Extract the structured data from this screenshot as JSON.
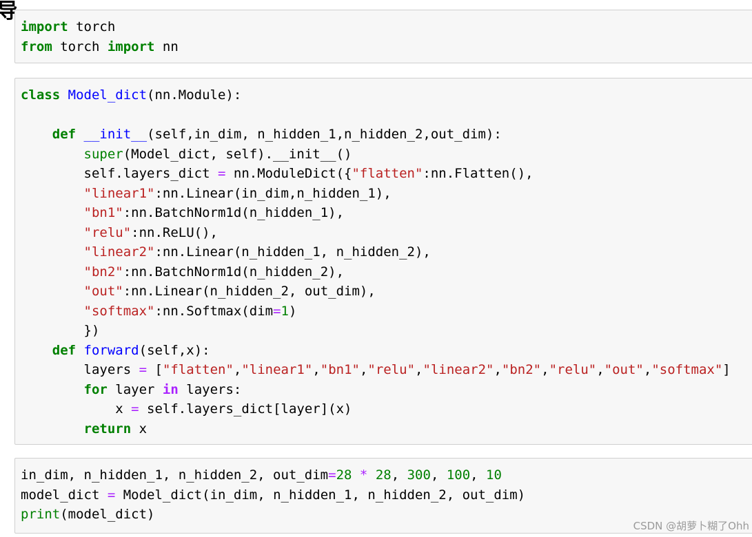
{
  "heading_fragment": "导",
  "cells": [
    {
      "lines": [
        [
          [
            "import",
            "kw"
          ],
          [
            " torch",
            ""
          ]
        ],
        [
          [
            "from",
            "kw"
          ],
          [
            " torch ",
            ""
          ],
          [
            "import",
            "kw"
          ],
          [
            " nn",
            ""
          ]
        ]
      ]
    },
    {
      "lines": [
        [
          [
            "class",
            "kw"
          ],
          [
            " ",
            ""
          ],
          [
            "Model_dict",
            "nc"
          ],
          [
            "(nn.Module):",
            ""
          ]
        ],
        [],
        [
          [
            "    ",
            ""
          ],
          [
            "def",
            "kw"
          ],
          [
            " ",
            ""
          ],
          [
            "__init__",
            "nf"
          ],
          [
            "(self,in_dim, n_hidden_1,n_hidden_2,out_dim):",
            ""
          ]
        ],
        [
          [
            "        ",
            ""
          ],
          [
            "super",
            "bi"
          ],
          [
            "(Model_dict, self).__init__()",
            ""
          ]
        ],
        [
          [
            "        self.layers_dict ",
            ""
          ],
          [
            "=",
            "o"
          ],
          [
            " nn.ModuleDict({",
            ""
          ],
          [
            "\"flatten\"",
            "s"
          ],
          [
            ":nn.Flatten(),",
            ""
          ]
        ],
        [
          [
            "        ",
            ""
          ],
          [
            "\"linear1\"",
            "s"
          ],
          [
            ":nn.Linear(in_dim,n_hidden_1),",
            ""
          ]
        ],
        [
          [
            "        ",
            ""
          ],
          [
            "\"bn1\"",
            "s"
          ],
          [
            ":nn.BatchNorm1d(n_hidden_1),",
            ""
          ]
        ],
        [
          [
            "        ",
            ""
          ],
          [
            "\"relu\"",
            "s"
          ],
          [
            ":nn.ReLU(),",
            ""
          ]
        ],
        [
          [
            "        ",
            ""
          ],
          [
            "\"linear2\"",
            "s"
          ],
          [
            ":nn.Linear(n_hidden_1, n_hidden_2),",
            ""
          ]
        ],
        [
          [
            "        ",
            ""
          ],
          [
            "\"bn2\"",
            "s"
          ],
          [
            ":nn.BatchNorm1d(n_hidden_2),",
            ""
          ]
        ],
        [
          [
            "        ",
            ""
          ],
          [
            "\"out\"",
            "s"
          ],
          [
            ":nn.Linear(n_hidden_2, out_dim),",
            ""
          ]
        ],
        [
          [
            "        ",
            ""
          ],
          [
            "\"softmax\"",
            "s"
          ],
          [
            ":nn.Softmax(dim",
            ""
          ],
          [
            "=",
            "o"
          ],
          [
            "1",
            "m"
          ],
          [
            ")",
            ""
          ]
        ],
        [
          [
            "        })",
            ""
          ]
        ],
        [
          [
            "    ",
            ""
          ],
          [
            "def",
            "kw"
          ],
          [
            " ",
            ""
          ],
          [
            "forward",
            "nf"
          ],
          [
            "(self,x):",
            ""
          ]
        ],
        [
          [
            "        layers ",
            ""
          ],
          [
            "=",
            "o"
          ],
          [
            " [",
            ""
          ],
          [
            "\"flatten\"",
            "s"
          ],
          [
            ",",
            ""
          ],
          [
            "\"linear1\"",
            "s"
          ],
          [
            ",",
            ""
          ],
          [
            "\"bn1\"",
            "s"
          ],
          [
            ",",
            ""
          ],
          [
            "\"relu\"",
            "s"
          ],
          [
            ",",
            ""
          ],
          [
            "\"linear2\"",
            "s"
          ],
          [
            ",",
            ""
          ],
          [
            "\"bn2\"",
            "s"
          ],
          [
            ",",
            ""
          ],
          [
            "\"relu\"",
            "s"
          ],
          [
            ",",
            ""
          ],
          [
            "\"out\"",
            "s"
          ],
          [
            ",",
            ""
          ],
          [
            "\"softmax\"",
            "s"
          ],
          [
            "]",
            ""
          ]
        ],
        [
          [
            "        ",
            ""
          ],
          [
            "for",
            "kw"
          ],
          [
            " layer ",
            ""
          ],
          [
            "in",
            "ow"
          ],
          [
            " layers:",
            ""
          ]
        ],
        [
          [
            "            x ",
            ""
          ],
          [
            "=",
            "o"
          ],
          [
            " self.layers_dict[layer](x)",
            ""
          ]
        ],
        [
          [
            "        ",
            ""
          ],
          [
            "return",
            "kw"
          ],
          [
            " x",
            ""
          ]
        ]
      ]
    },
    {
      "lines": [
        [
          [
            "in_dim, n_hidden_1, n_hidden_2, out_dim",
            ""
          ],
          [
            "=",
            "o"
          ],
          [
            "28",
            "m"
          ],
          [
            " ",
            ""
          ],
          [
            "*",
            "o"
          ],
          [
            " ",
            ""
          ],
          [
            "28",
            "m"
          ],
          [
            ", ",
            ""
          ],
          [
            "300",
            "m"
          ],
          [
            ", ",
            ""
          ],
          [
            "100",
            "m"
          ],
          [
            ", ",
            ""
          ],
          [
            "10",
            "m"
          ]
        ],
        [
          [
            "model_dict ",
            ""
          ],
          [
            "=",
            "o"
          ],
          [
            " Model_dict(in_dim, n_hidden_1, n_hidden_2, out_dim)",
            ""
          ]
        ],
        [
          [
            "print",
            "bi"
          ],
          [
            "(model_dict)",
            ""
          ]
        ]
      ]
    }
  ],
  "watermark": "CSDN @胡萝卜糊了Ohh"
}
